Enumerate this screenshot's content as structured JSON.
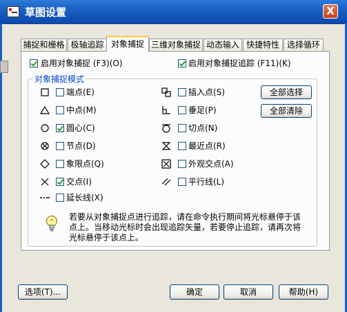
{
  "window": {
    "title": "草图设置",
    "close_glyph": "X"
  },
  "tabs": [
    {
      "label": "捕捉和栅格"
    },
    {
      "label": "极轴追踪"
    },
    {
      "label": "对象捕捉"
    },
    {
      "label": "三维对象捕捉"
    },
    {
      "label": "动态输入"
    },
    {
      "label": "快捷特性"
    },
    {
      "label": "选择循环"
    }
  ],
  "active_tab": "对象捕捉",
  "top_options": {
    "enable_osnap": {
      "label": "启用对象捕捉 (F3)(O)",
      "checked": true
    },
    "enable_tracking": {
      "label": "启用对象捕捉追踪 (F11)(K)",
      "checked": true
    }
  },
  "group": {
    "title": "对象捕捉模式",
    "left": [
      {
        "label": "端点(E)",
        "checked": false,
        "icon": "square-icon"
      },
      {
        "label": "中点(M)",
        "checked": false,
        "icon": "triangle-icon"
      },
      {
        "label": "圆心(C)",
        "checked": true,
        "icon": "circle-icon"
      },
      {
        "label": "节点(D)",
        "checked": false,
        "icon": "node-icon"
      },
      {
        "label": "象限点(Q)",
        "checked": false,
        "icon": "diamond-icon"
      },
      {
        "label": "交点(I)",
        "checked": true,
        "icon": "x-icon"
      },
      {
        "label": "延长线(X)",
        "checked": false,
        "icon": "extension-icon"
      }
    ],
    "right": [
      {
        "label": "插入点(S)",
        "checked": false,
        "icon": "insert-icon"
      },
      {
        "label": "垂足(P)",
        "checked": false,
        "icon": "perpendicular-icon"
      },
      {
        "label": "切点(N)",
        "checked": false,
        "icon": "tangent-icon"
      },
      {
        "label": "最近点(R)",
        "checked": false,
        "icon": "nearest-icon"
      },
      {
        "label": "外观交点(A)",
        "checked": false,
        "icon": "apparent-intersection-icon"
      },
      {
        "label": "平行线(L)",
        "checked": false,
        "icon": "parallel-icon"
      }
    ],
    "select_all": "全部选择",
    "clear_all": "全部清除"
  },
  "info": {
    "icon": "lightbulb-icon",
    "text": "若要从对象捕捉点进行追踪，请在命令执行期间将光标悬停于该点上。当移动光标时会出现追踪矢量，若要停止追踪，请再次将光标悬停于该点上。"
  },
  "footer": {
    "options": "选项(T)...",
    "ok": "确定",
    "cancel": "取消",
    "help": "帮助(H)"
  }
}
